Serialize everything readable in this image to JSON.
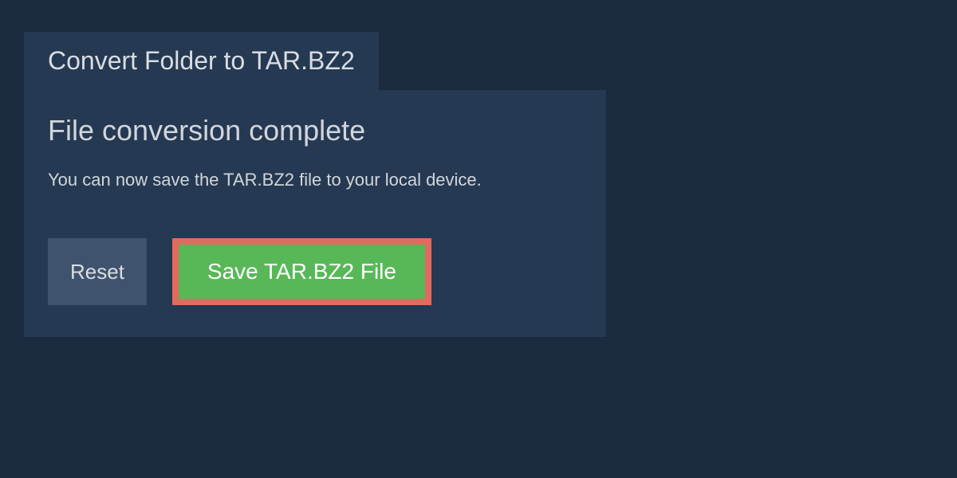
{
  "tab": {
    "title": "Convert Folder to TAR.BZ2"
  },
  "panel": {
    "title": "File conversion complete",
    "message": "You can now save the TAR.BZ2 file to your local device."
  },
  "buttons": {
    "reset_label": "Reset",
    "save_label": "Save TAR.BZ2 File"
  }
}
